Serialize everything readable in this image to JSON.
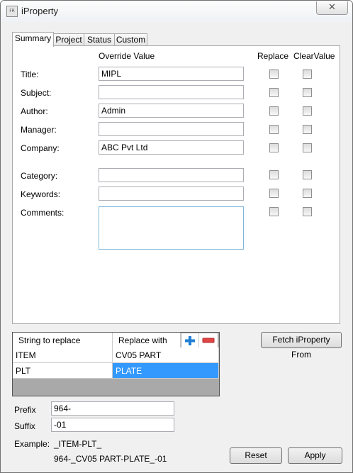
{
  "window": {
    "title": "iProperty",
    "app_icon_text": "FR",
    "close_symbol": "✕"
  },
  "tabs": [
    {
      "label": "Summary",
      "active": true
    },
    {
      "label": "Project",
      "active": false
    },
    {
      "label": "Status",
      "active": false
    },
    {
      "label": "Custom",
      "active": false
    }
  ],
  "summary": {
    "col_override": "Override Value",
    "col_replace": "Replace",
    "col_clear": "ClearValue",
    "fields": [
      {
        "label": "Title:",
        "value": "MIPL",
        "replace": false,
        "clear": false
      },
      {
        "label": "Subject:",
        "value": "",
        "replace": false,
        "clear": false
      },
      {
        "label": "Author:",
        "value": "Admin",
        "replace": false,
        "clear": false
      },
      {
        "label": "Manager:",
        "value": "",
        "replace": false,
        "clear": false
      },
      {
        "label": "Company:",
        "value": "ABC Pvt Ltd",
        "replace": false,
        "clear": false
      },
      {
        "label": "Category:",
        "value": "",
        "replace": false,
        "clear": false
      },
      {
        "label": "Keywords:",
        "value": "",
        "replace": false,
        "clear": false
      },
      {
        "label": "Comments:",
        "value": "",
        "replace": false,
        "clear": false
      }
    ]
  },
  "replace_table": {
    "headers": [
      "String to replace",
      "Replace with"
    ],
    "rows": [
      {
        "find": "ITEM",
        "replace": "CV05 PART",
        "selected": false
      },
      {
        "find": "PLT",
        "replace": "PLATE",
        "selected": true
      }
    ],
    "add_icon": "plus-icon",
    "remove_icon": "minus-icon",
    "add_color": "#1f7fd6",
    "remove_color": "#e04444"
  },
  "fetch_button": "Fetch iProperty From",
  "prefix": {
    "label": "Prefix",
    "value": "964-"
  },
  "suffix": {
    "label": "Suffix",
    "value": "-01"
  },
  "example": {
    "label": "Example:",
    "pattern": "_ITEM-PLT_",
    "result": "964-_CV05 PART-PLATE_-01"
  },
  "buttons": {
    "reset": "Reset",
    "apply": "Apply"
  }
}
